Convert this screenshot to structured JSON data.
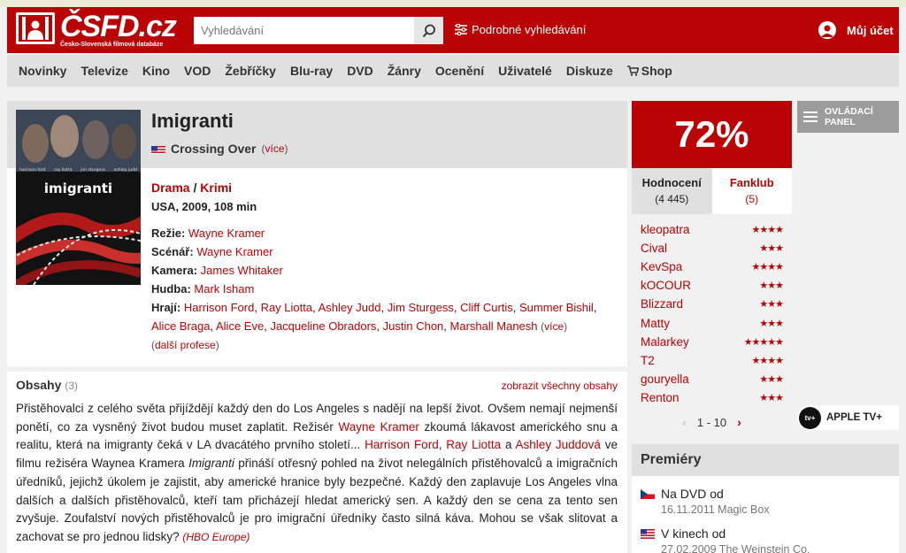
{
  "header": {
    "logo_text": "ČSFD.cz",
    "logo_subtitle": "Česko-Slovenská filmová databáze",
    "search_placeholder": "Vyhledávání",
    "advanced_search": "Podrobné vyhledávání",
    "account": "Můj účet"
  },
  "nav": {
    "items": [
      "Novinky",
      "Televize",
      "Kino",
      "VOD",
      "Žebříčky",
      "Blu-ray",
      "DVD",
      "Žánry",
      "Ocenění",
      "Uživatelé",
      "Diskuze",
      "Shop"
    ]
  },
  "film": {
    "title": "Imigranti",
    "original_title": "Crossing Over",
    "more": "více",
    "genre_1": "Drama",
    "genre_sep": " / ",
    "genre_2": "Krimi",
    "origin": "USA, 2009, 108 min",
    "poster_title": "imigranti",
    "poster_names": [
      "harrison ford",
      "ray liotta",
      "jim sturgess",
      "ashley judd"
    ],
    "crew": {
      "director_label": "Režie:",
      "director": "Wayne Kramer",
      "writer_label": "Scénář:",
      "writer": "Wayne Kramer",
      "camera_label": "Kamera:",
      "camera": "James Whitaker",
      "music_label": "Hudba:",
      "music": "Mark Isham",
      "cast_label": "Hrají:",
      "cast": [
        "Harrison Ford",
        "Ray Liotta",
        "Ashley Judd",
        "Jim Sturgess",
        "Cliff Curtis",
        "Summer Bishil",
        "Alice Braga",
        "Alice Eve",
        "Jacqueline Obradors",
        "Justin Chon",
        "Marshall Manesh"
      ],
      "cast_more": "více",
      "more_professions": "další profese"
    }
  },
  "plot": {
    "heading": "Obsahy",
    "count": "(3)",
    "show_all": "zobrazit všechny obsahy",
    "t1": "Přistěhovalci z celého světa přijíždějí každý den do Los Angeles s nadějí na lepší život. Ovšem nemají nejmenší ponětí, co za vysněný život budou muset zaplatit. Režisér ",
    "l1": "Wayne Kramer",
    "t2": " zkoumá lákavost amerického snu a realitu, která na imigranty čeká v LA dvacátého prvního století... ",
    "l2": "Harrison Ford",
    "t3": ", ",
    "l3": "Ray Liotta",
    "t4": " a ",
    "l4": "Ashley Juddová",
    "t5": " ve filmu režiséra Waynea Kramera ",
    "t6": "Imigranti",
    "t7": " přináší otřesný pohled na život nelegálních přistěhovalců a imigračních úředníků, jejichž úkolem je zajistit, aby americké hranice byly bezpečné. Každý den zaplavuje Los Angeles vlna dalších a dalších přistěhovalců, kteří tam přicházejí hledat americký sen. A každý den se cena za tento sen zvyšuje. Zoufalství nových přistěhovalců je pro imigrační úředníky často silná káva. Mohou se však slitovat a zachovat se pro jednou lidsky? ",
    "source": "(HBO Europe)"
  },
  "rating": {
    "percent": "72%",
    "tab_ratings": "Hodnocení",
    "tab_ratings_count": "(4 445)",
    "tab_fanclub": "Fanklub",
    "tab_fanclub_count": "(5)",
    "users": [
      {
        "name": "kleopatra",
        "stars": "★★★★"
      },
      {
        "name": "Cival",
        "stars": "★★★"
      },
      {
        "name": "KevSpa",
        "stars": "★★★★"
      },
      {
        "name": "kOCOUR",
        "stars": "★★★"
      },
      {
        "name": "Blizzard",
        "stars": "★★★"
      },
      {
        "name": "Matty",
        "stars": "★★★"
      },
      {
        "name": "Malarkey",
        "stars": "★★★★★"
      },
      {
        "name": "T2",
        "stars": "★★★★"
      },
      {
        "name": "gouryella",
        "stars": "★★★"
      },
      {
        "name": "Renton",
        "stars": "★★★"
      }
    ],
    "pager": "1 - 10"
  },
  "premieres": {
    "heading": "Premiéry",
    "items": [
      {
        "label": "Na DVD od",
        "date": "16.11.2011 Magic Box"
      },
      {
        "label": "V kinech od",
        "date": "27.02.2009 The Weinstein Co."
      }
    ]
  },
  "side": {
    "control_panel": "OVLÁDACÍ PANEL",
    "appletv": "APPLE TV+",
    "appletv_logo": "tv+"
  },
  "colors": {
    "brand_red": "#ba0305",
    "nav_gray": "#e0e0e0"
  }
}
